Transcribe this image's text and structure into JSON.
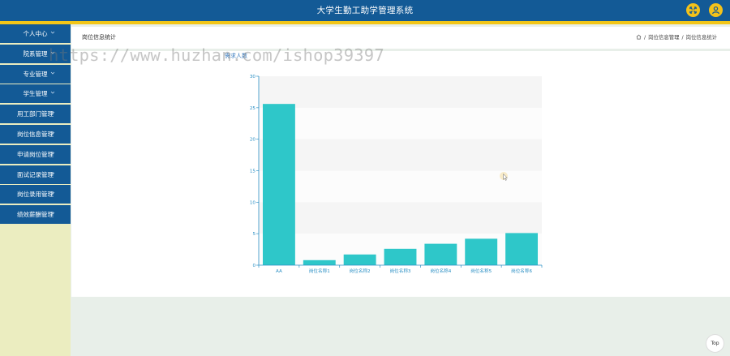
{
  "app": {
    "title": "大学生勤工助学管理系统"
  },
  "topbar": {
    "icons": [
      "expand-icon",
      "user-icon"
    ],
    "accent_color": "#f3c21a",
    "bar_color": "#135a96"
  },
  "sidebar": {
    "items": [
      {
        "label": "个人中心"
      },
      {
        "label": "院系管理"
      },
      {
        "label": "专业管理"
      },
      {
        "label": "学生管理"
      },
      {
        "label": "用工部门管理"
      },
      {
        "label": "岗位信息管理"
      },
      {
        "label": "申请岗位管理"
      },
      {
        "label": "面试记录管理"
      },
      {
        "label": "岗位录用管理"
      },
      {
        "label": "绩效薪酬管理"
      }
    ]
  },
  "page": {
    "title": "岗位信息统计",
    "breadcrumb": [
      "岗位信息管理",
      "岗位信息统计"
    ],
    "breadcrumb_sep": "/",
    "legend_stub": "需求人数"
  },
  "watermark": "https://www.huzhan.com/ishop39397",
  "top_button": "Top",
  "chart_data": {
    "type": "bar",
    "categories": [
      "AA",
      "岗位名称1",
      "岗位名称2",
      "岗位名称3",
      "岗位名称4",
      "岗位名称5",
      "岗位名称6"
    ],
    "values": [
      25.6,
      0.8,
      1.7,
      2.6,
      3.4,
      4.2,
      5.1
    ],
    "ylim": [
      0,
      30
    ],
    "yticks": [
      0,
      5,
      10,
      15,
      20,
      25,
      30
    ],
    "bar_color": "#2ec7c9",
    "axis_color": "#2a8fc4"
  }
}
